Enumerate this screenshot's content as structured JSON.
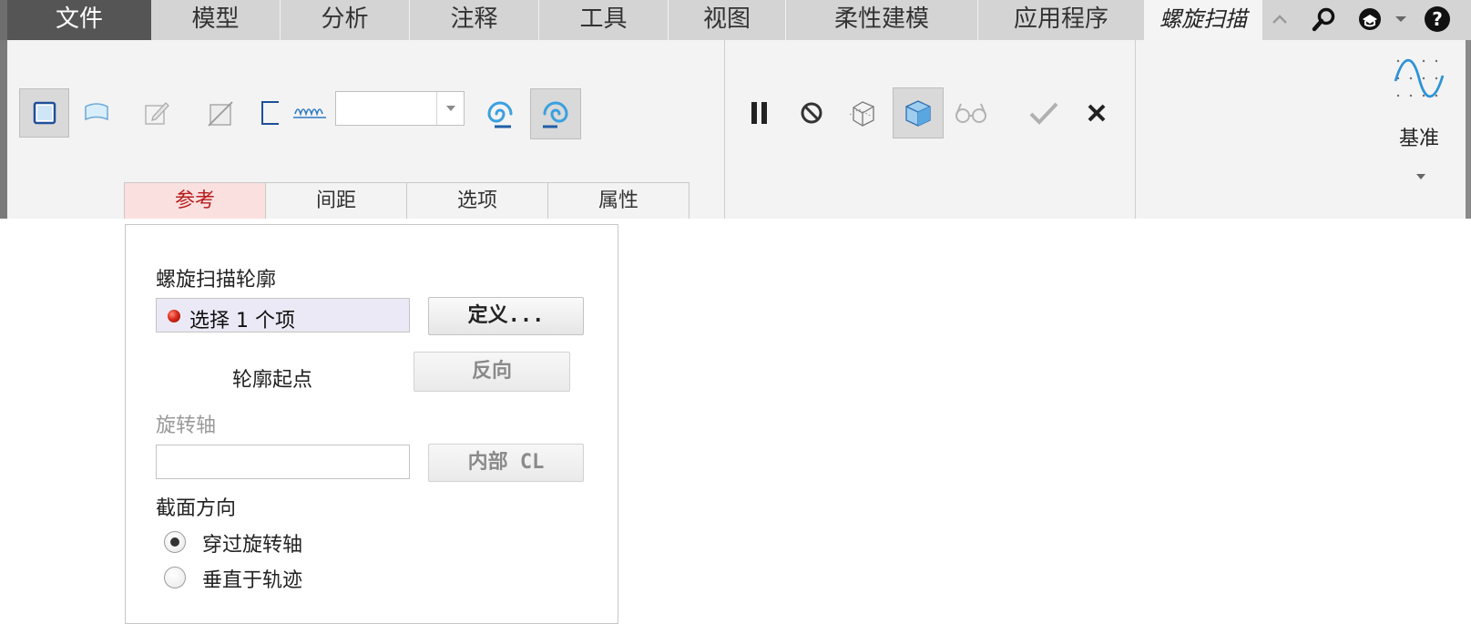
{
  "menu": {
    "tabs": [
      {
        "label": "文件"
      },
      {
        "label": "模型"
      },
      {
        "label": "分析"
      },
      {
        "label": "注释"
      },
      {
        "label": "工具"
      },
      {
        "label": "视图"
      },
      {
        "label": "柔性建模"
      },
      {
        "label": "应用程序"
      },
      {
        "label": "螺旋扫描"
      }
    ],
    "icons": [
      "collapse-ribbon-icon",
      "search-icon",
      "community-icon",
      "dropdown-icon",
      "help-icon"
    ]
  },
  "ribbon": {
    "tool_icons": [
      "solid-icon",
      "surface-icon",
      "sketch-edit-icon",
      "remove-material-icon",
      "thicken-icon",
      "pitch-icon"
    ],
    "pitch_value": "",
    "handedness_icons": [
      "left-handed-icon",
      "right-handed-icon"
    ],
    "control_icons": [
      "pause-icon",
      "no-preview-icon",
      "preview-icon",
      "verify-preview-icon",
      "glasses-preview-icon",
      "ok-check-icon",
      "cancel-x-icon"
    ],
    "subtabs": [
      {
        "label": "参考"
      },
      {
        "label": "间距"
      },
      {
        "label": "选项"
      },
      {
        "label": "属性"
      }
    ],
    "datum": {
      "label": "基准",
      "icon": "datum-curve-icon"
    }
  },
  "panel": {
    "profile_label": "螺旋扫描轮廓",
    "profile_field": "选择 1 个项",
    "define_button": "定义...",
    "start_point_label": "轮廓起点",
    "flip_button": "反向",
    "axis_label": "旋转轴",
    "axis_field": "",
    "internal_cl_button": "内部 CL",
    "section_orientation_label": "截面方向",
    "options": [
      {
        "label": "穿过旋转轴",
        "selected": true
      },
      {
        "label": "垂直于轨迹",
        "selected": false
      }
    ]
  },
  "colors": {
    "active_subtab_text": "#b81c1c",
    "active_subtab_bg": "#fbe0e0",
    "icon_blue": "#3aa0e0",
    "file_tab_bg": "#555555"
  }
}
